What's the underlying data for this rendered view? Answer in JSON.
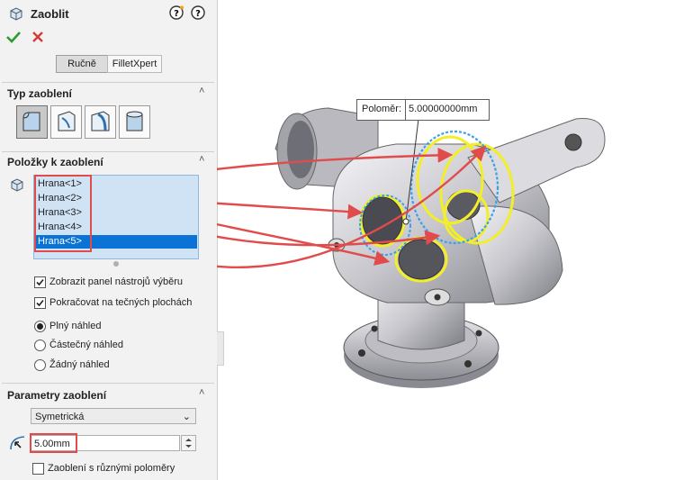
{
  "header": {
    "title": "Zaoblit"
  },
  "modes": {
    "manual": "Ručně",
    "expert": "FilletXpert"
  },
  "sections": {
    "type_title": "Typ zaoblení",
    "items_title": "Položky k zaoblení",
    "params_title": "Parametry zaoblení"
  },
  "items": [
    "Hrana<1>",
    "Hrana<2>",
    "Hrana<3>",
    "Hrana<4>",
    "Hrana<5>"
  ],
  "options": {
    "show_toolbar": "Zobrazit panel nástrojů výběru",
    "tangent": "Pokračovat na tečných plochách",
    "preview_full": "Plný náhled",
    "preview_partial": "Částečný náhled",
    "preview_none": "Žádný náhled"
  },
  "params": {
    "profile": "Symetrická",
    "radius": "5.00mm",
    "multi_radius": "Zaoblení s různými poloměry"
  },
  "callout": {
    "label": "Poloměr:",
    "value": "5.00000000mm"
  },
  "colors": {
    "accent_red": "#e14b4b",
    "selection_blue": "#0c73d6",
    "edge_yellow": "#f2ee2a"
  }
}
